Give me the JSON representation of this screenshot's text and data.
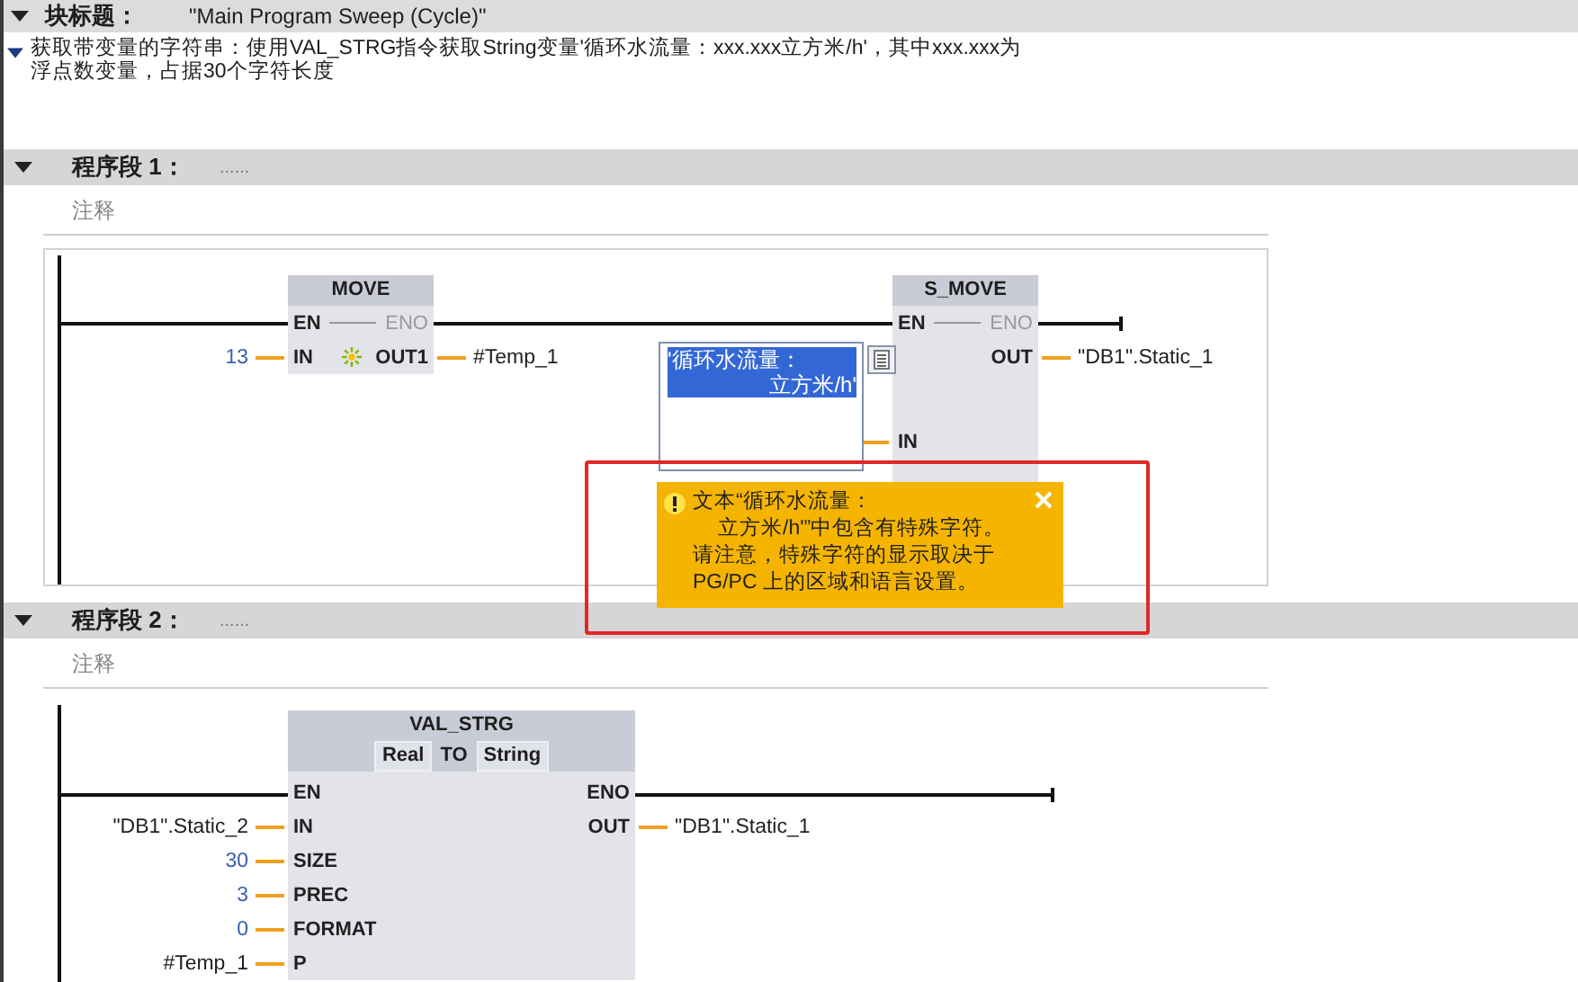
{
  "block_title": {
    "label": "块标题：",
    "value": "\"Main Program Sweep (Cycle)\"",
    "expanded": true
  },
  "block_comment": {
    "lines": [
      "获取带变量的字符串：使用VAL_STRG指令获取String变量'循环水流量：xxx.xxx立方米/h'，其中xxx.xxx为",
      "浮点数变量，占据30个字符长度"
    ],
    "expanded": true
  },
  "networks": [
    {
      "title": "程序段 1：",
      "dots": "......",
      "comment": "注释",
      "expanded": true,
      "selected": true,
      "blocks": [
        {
          "title": "MOVE",
          "en": "EN",
          "eno": "ENO",
          "eno_active": false,
          "rows": [
            {
              "left_pin": "IN",
              "left_operand": "13",
              "left_constant": true,
              "right_pin": "OUT1",
              "right_operand": "#Temp_1",
              "right_constant": false,
              "extensible": true
            }
          ]
        },
        {
          "title": "S_MOVE",
          "en": "EN",
          "eno": "ENO",
          "eno_active": false,
          "rows": [
            {
              "right_pin": "OUT",
              "right_operand": "\"DB1\".Static_1",
              "right_constant": false,
              "extensible": false
            },
            {
              "left_pin": "IN",
              "extensible": false
            }
          ]
        }
      ]
    },
    {
      "title": "程序段 2：",
      "dots": "......",
      "comment": "注释",
      "expanded": true,
      "selected": false,
      "blocks": [
        {
          "title": "VAL_STRG",
          "types": [
            {
              "text": "Real",
              "kind": "datatype"
            },
            {
              "text": "TO",
              "kind": "keyword"
            },
            {
              "text": "String",
              "kind": "datatype"
            }
          ],
          "en": "EN",
          "eno": "ENO",
          "eno_active": true,
          "rows": [
            {
              "left_pin": "IN",
              "left_operand": "\"DB1\".Static_2",
              "left_constant": false,
              "right_pin": "OUT",
              "right_operand": "\"DB1\".Static_1",
              "right_constant": false,
              "extensible": false
            },
            {
              "left_pin": "SIZE",
              "left_operand": "30",
              "left_constant": true,
              "extensible": false
            },
            {
              "left_pin": "PREC",
              "left_operand": "3",
              "left_constant": true,
              "extensible": false
            },
            {
              "left_pin": "FORMAT",
              "left_operand": "0",
              "left_constant": true,
              "extensible": false
            },
            {
              "left_pin": "P",
              "left_operand": "#Temp_1",
              "left_constant": false,
              "extensible": false
            }
          ]
        }
      ]
    }
  ],
  "operand_editor": {
    "lines": [
      "'循环水流量：",
      "立方米/h'"
    ],
    "selected": true
  },
  "warning": {
    "lines": [
      "文本“循环水流量：",
      "立方米/h'”中包含有特殊字符。",
      "请注意，特殊字符的显示取决于",
      "PG/PC 上的区域和语言设置。"
    ]
  }
}
